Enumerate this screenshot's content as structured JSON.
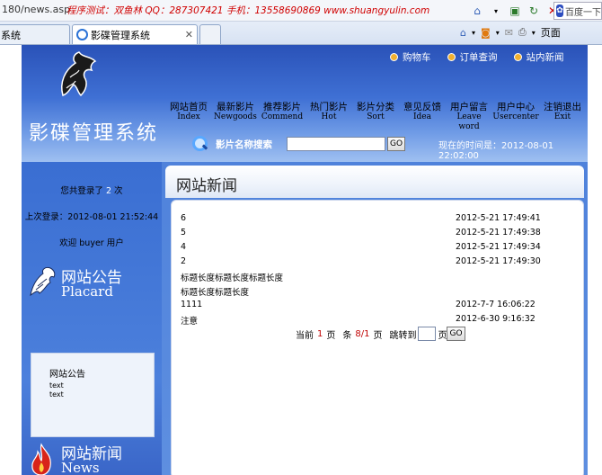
{
  "browser": {
    "url": "180/news.asp",
    "marquee": "程序测试：双鱼林  QQ：287307421  手机：13558690869  www.shuangyulin.com",
    "search_brand": "百度一下",
    "tabs": [
      {
        "label": "系统"
      },
      {
        "label": "影碟管理系统"
      }
    ],
    "cmd_page": "页面"
  },
  "header": {
    "site_title": "影碟管理系统",
    "topnav": [
      {
        "label": "购物车"
      },
      {
        "label": "订单查询"
      },
      {
        "label": "站内新闻"
      }
    ],
    "mainnav": [
      {
        "cn": "网站首页",
        "en": "Index"
      },
      {
        "cn": "最新影片",
        "en": "Newgoods"
      },
      {
        "cn": "推荐影片",
        "en": "Commend"
      },
      {
        "cn": "热门影片",
        "en": "Hot"
      },
      {
        "cn": "影片分类",
        "en": "Sort"
      },
      {
        "cn": "意见反馈",
        "en": "Idea"
      },
      {
        "cn": "用户留言",
        "en": "Leave word"
      },
      {
        "cn": "用户中心",
        "en": "Usercenter"
      },
      {
        "cn": "注销退出",
        "en": "Exit"
      }
    ],
    "search_label": "影片名称搜索",
    "go": "GO",
    "clock": "现在的时间是：2012-08-01 22:02:00"
  },
  "sidebar": {
    "login_prefix": "您共登录了",
    "login_count": "2",
    "login_suffix": "次",
    "last_login": "上次登录：2012-08-01 21:52:44",
    "welcome_prefix": "欢迎",
    "username": "buyer",
    "welcome_suffix": "用户",
    "placard_cn": "网站公告",
    "placard_en": "Placard",
    "notice": {
      "title": "网站公告",
      "lines": [
        "text",
        "text"
      ]
    },
    "news_cn": "网站新闻",
    "news_en": "News"
  },
  "content": {
    "title": "网站新闻",
    "rows": [
      {
        "title": "6",
        "date": "2012-5-21 17:49:41"
      },
      {
        "title": "5",
        "date": "2012-5-21 17:49:38"
      },
      {
        "title": "4",
        "date": "2012-5-21 17:49:34"
      },
      {
        "title": "2",
        "date": "2012-5-21 17:49:30"
      },
      {
        "title": "标题长度标题长度标题长度",
        "date": ""
      },
      {
        "title": "标题长度标题长度",
        "date": ""
      },
      {
        "title": "1111",
        "date": "2012-7-7 16:06:22"
      },
      {
        "title": "注意",
        "date": "2012-6-30 9:16:32"
      }
    ],
    "pager": {
      "current_label": "当前",
      "current": "1",
      "page_unit": "页",
      "record_label": "条",
      "pages": "8/1",
      "jump_label": "跳转到",
      "go": "GO"
    }
  }
}
